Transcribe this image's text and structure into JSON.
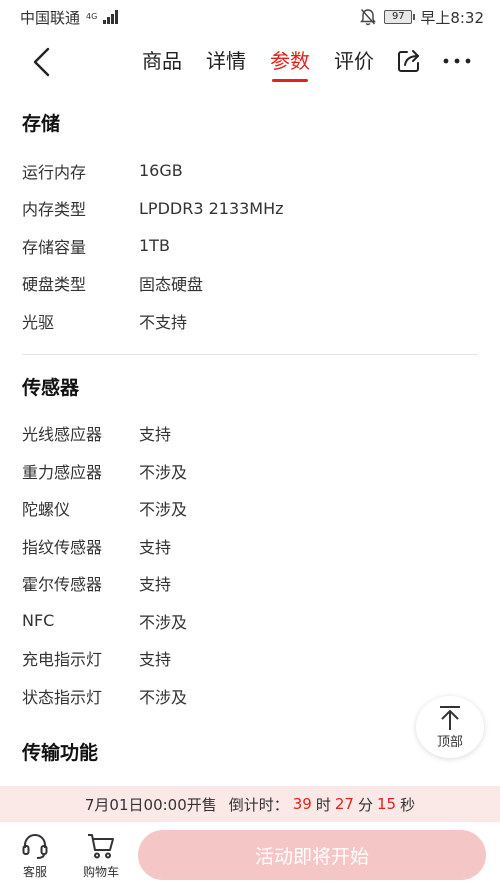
{
  "status": {
    "carrier": "中国联通",
    "net_top": "4G",
    "net_bottom": "",
    "battery": "97",
    "time": "早上8:32"
  },
  "nav": {
    "tabs": [
      "商品",
      "详情",
      "参数",
      "评价"
    ],
    "active": 2
  },
  "sections": [
    {
      "title": "存储",
      "rows": [
        {
          "label": "运行内存",
          "value": "16GB"
        },
        {
          "label": "内存类型",
          "value": "LPDDR3 2133MHz"
        },
        {
          "label": "存储容量",
          "value": "1TB"
        },
        {
          "label": "硬盘类型",
          "value": "固态硬盘"
        },
        {
          "label": "光驱",
          "value": "不支持"
        }
      ]
    },
    {
      "title": "传感器",
      "rows": [
        {
          "label": "光线感应器",
          "value": "支持"
        },
        {
          "label": "重力感应器",
          "value": "不涉及"
        },
        {
          "label": "陀螺仪",
          "value": "不涉及"
        },
        {
          "label": "指纹传感器",
          "value": "支持"
        },
        {
          "label": "霍尔传感器",
          "value": "支持"
        },
        {
          "label": "NFC",
          "value": "不涉及"
        },
        {
          "label": "充电指示灯",
          "value": "支持"
        },
        {
          "label": "状态指示灯",
          "value": "不涉及"
        }
      ]
    },
    {
      "title": "传输功能",
      "rows": []
    }
  ],
  "top_button": {
    "label": "顶部"
  },
  "countdown": {
    "prefix": "7月01日00:00开售",
    "label": "倒计时：",
    "hours": "39",
    "h_unit": "时",
    "minutes": "27",
    "m_unit": "分",
    "seconds": "15",
    "s_unit": "秒"
  },
  "bottom": {
    "service": "客服",
    "cart": "购物车",
    "cta": "活动即将开始"
  },
  "colors": {
    "accent": "#e2231a",
    "cta_bg": "#f5c6c6",
    "countdown_bg": "#fbe9e7"
  }
}
